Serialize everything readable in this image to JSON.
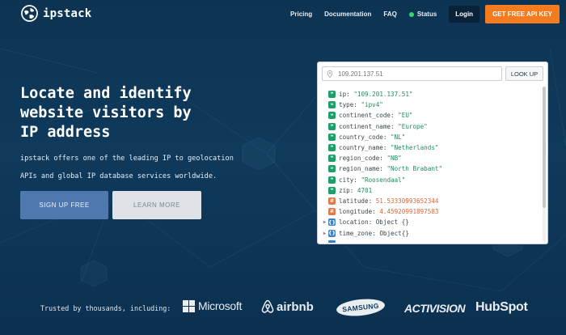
{
  "brand": {
    "logo_text": "ipstack",
    "logo_icon": "globe-icon"
  },
  "nav": {
    "links": [
      "Pricing",
      "Documentation",
      "FAQ"
    ],
    "status_label": "Status",
    "status_color": "#3bd16f",
    "login_label": "Login",
    "cta_label": "GET FREE API KEY",
    "cta_color": "#f47b20"
  },
  "hero": {
    "headline_lines": [
      "Locate and identify",
      "website visitors by",
      "IP address"
    ],
    "sub_lines": [
      "ipstack offers one of the leading IP to geolocation",
      "APIs and global IP database services worldwide."
    ],
    "signup_label": "SIGN UP FREE",
    "learn_label": "LEARN MORE"
  },
  "lookup": {
    "ip_value": "109.201.137.51",
    "button_label": "LOOK UP",
    "rows": [
      {
        "type": "str",
        "key": "ip",
        "value": "\"109.201.137.51\""
      },
      {
        "type": "str",
        "key": "type",
        "value": "\"ipv4\""
      },
      {
        "type": "str",
        "key": "continent_code",
        "value": "\"EU\""
      },
      {
        "type": "str",
        "key": "continent_name",
        "value": "\"Europe\""
      },
      {
        "type": "str",
        "key": "country_code",
        "value": "\"NL\""
      },
      {
        "type": "str",
        "key": "country_name",
        "value": "\"Netherlands\""
      },
      {
        "type": "str",
        "key": "region_code",
        "value": "\"NB\""
      },
      {
        "type": "str",
        "key": "region_name",
        "value": "\"North Brabant\""
      },
      {
        "type": "str",
        "key": "city",
        "value": "\"Roosendaal\""
      },
      {
        "type": "str",
        "key": "zip",
        "value": "4701"
      },
      {
        "type": "num",
        "key": "latitude",
        "value": "51.53330993652344"
      },
      {
        "type": "num",
        "key": "longitude",
        "value": "4.45920991897583"
      },
      {
        "type": "obj",
        "key": "location",
        "value": "Object {}"
      },
      {
        "type": "obj",
        "key": "time_zone",
        "value": "Object{}"
      }
    ]
  },
  "trusted": {
    "label": "Trusted by thousands, including:",
    "logos": [
      "Microsoft",
      "airbnb",
      "SAMSUNG",
      "ACTIVISION",
      "HubSpot"
    ]
  }
}
